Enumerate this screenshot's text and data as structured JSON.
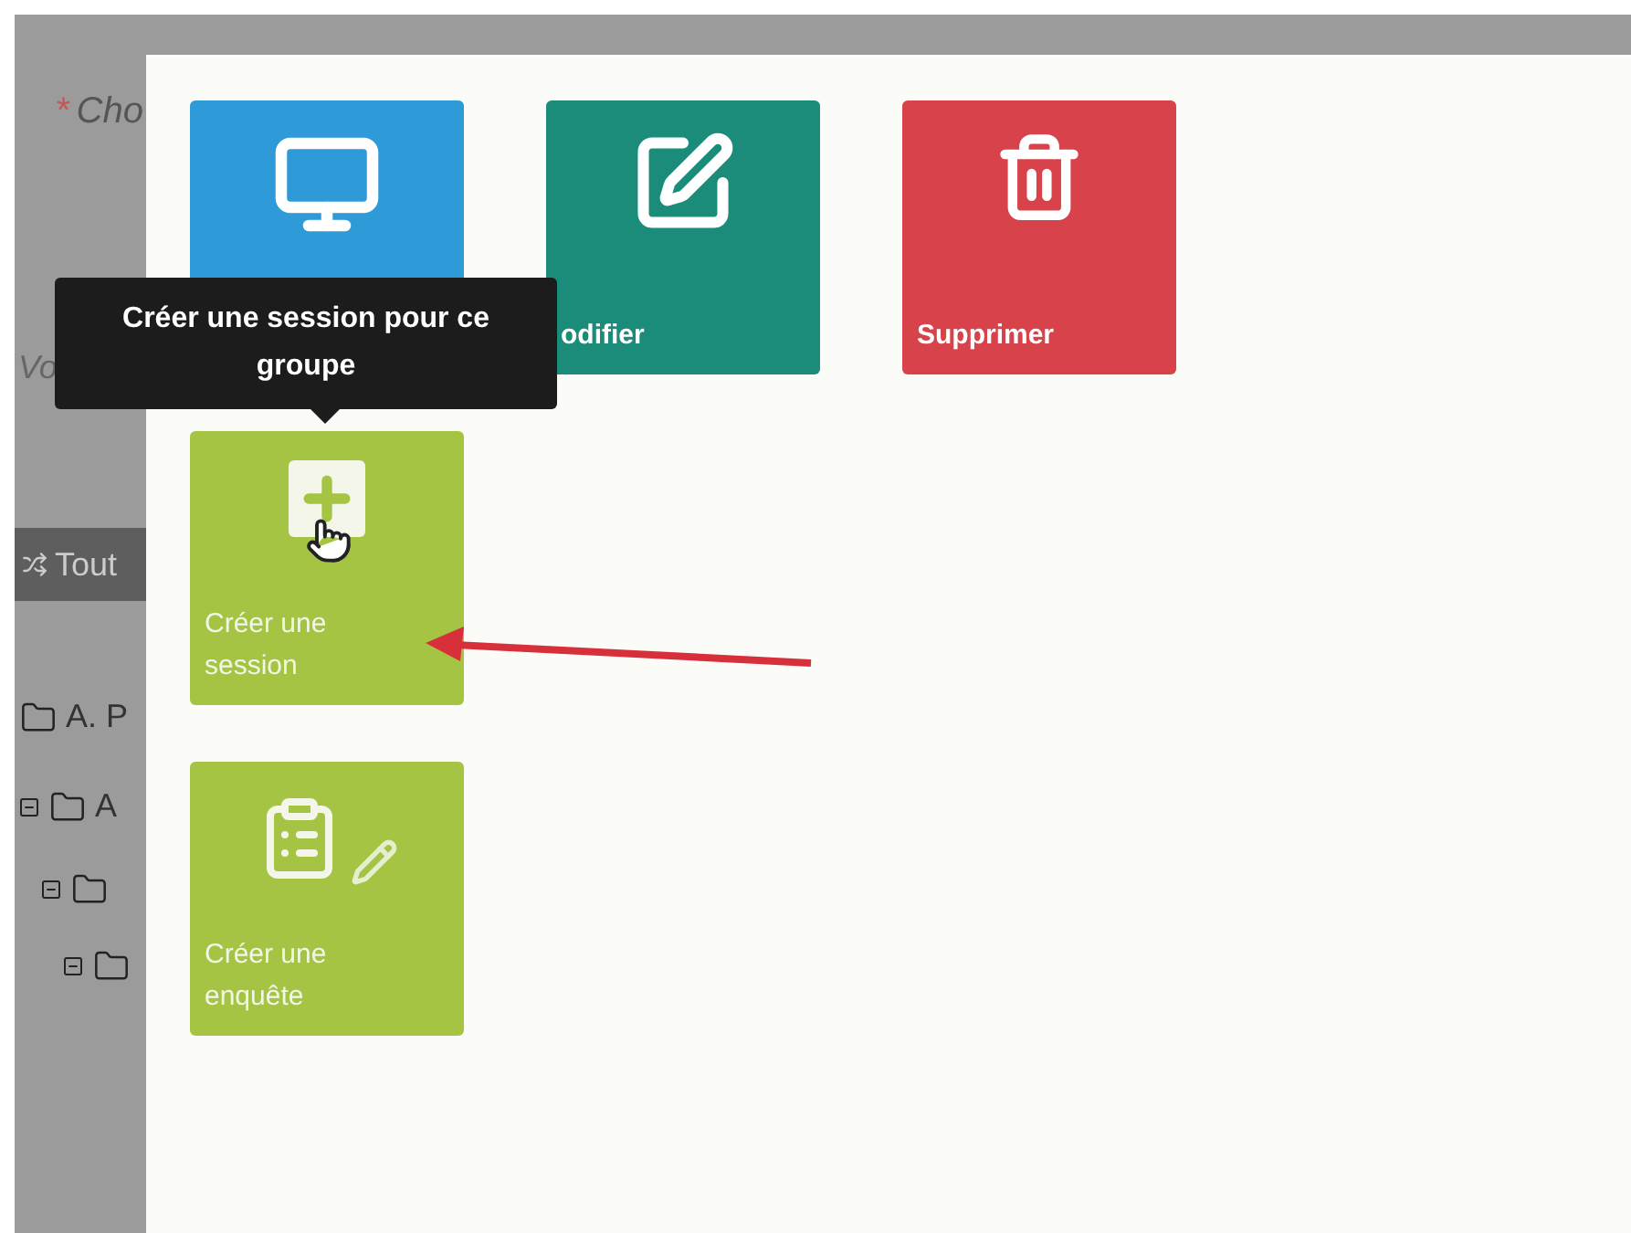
{
  "background": {
    "field_label": {
      "marker": "*",
      "text": "Cho"
    },
    "field_hint": "Vo",
    "toolbar_button": "Tout",
    "tree": [
      {
        "label": "A. P",
        "expanded": false
      },
      {
        "label": "A",
        "expanded": true,
        "children": [
          {
            "expanded": true,
            "children": [
              {
                "expanded": true
              }
            ]
          }
        ]
      }
    ]
  },
  "tile_rows": [
    [
      {
        "kind": "monitor",
        "color": "#2f9ad8",
        "hovered": false
      },
      {
        "kind": "edit",
        "color": "#1b8c79",
        "label": "odifier",
        "hovered": false
      },
      {
        "kind": "trash",
        "color": "#d8434b",
        "label": "Supprimer",
        "hovered": false
      }
    ],
    [
      {
        "kind": "plus",
        "color": "#a5c444",
        "label": "Créer une session",
        "hovered": true
      }
    ],
    [
      {
        "kind": "survey",
        "color": "#a5c444",
        "label": "Créer une enquête",
        "hovered": false
      }
    ]
  ],
  "tooltip": "Créer une session pour ce groupe"
}
